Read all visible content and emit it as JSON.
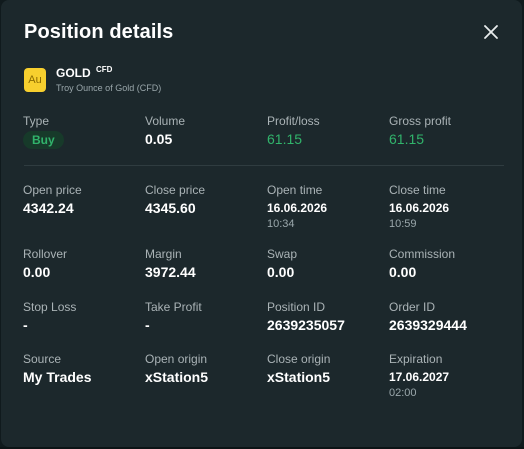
{
  "dialog": {
    "title": "Position details",
    "close_icon": "close-icon"
  },
  "instrument": {
    "logo_text": "Au",
    "logo_color": "#f7cf2e",
    "symbol": "GOLD",
    "tag": "CFD",
    "description": "Troy Ounce of Gold (CFD)"
  },
  "summary": {
    "type": {
      "label": "Type",
      "value": "Buy"
    },
    "volume": {
      "label": "Volume",
      "value": "0.05"
    },
    "profit_loss": {
      "label": "Profit/loss",
      "value": "61.15"
    },
    "gross_profit": {
      "label": "Gross profit",
      "value": "61.15"
    }
  },
  "details": {
    "open_price": {
      "label": "Open price",
      "value": "4342.24"
    },
    "close_price": {
      "label": "Close price",
      "value": "4345.60"
    },
    "open_time": {
      "label": "Open time",
      "date": "16.06.2026",
      "time": "10:34"
    },
    "close_time": {
      "label": "Close time",
      "date": "16.06.2026",
      "time": "10:59"
    },
    "rollover": {
      "label": "Rollover",
      "value": "0.00"
    },
    "margin": {
      "label": "Margin",
      "value": "3972.44"
    },
    "swap": {
      "label": "Swap",
      "value": "0.00"
    },
    "commission": {
      "label": "Commission",
      "value": "0.00"
    },
    "stop_loss": {
      "label": "Stop Loss",
      "value": "-"
    },
    "take_profit": {
      "label": "Take Profit",
      "value": "-"
    },
    "position_id": {
      "label": "Position ID",
      "value": "2639235057"
    },
    "order_id": {
      "label": "Order ID",
      "value": "2639329444"
    },
    "source": {
      "label": "Source",
      "value": "My Trades"
    },
    "open_origin": {
      "label": "Open origin",
      "value": "xStation5"
    },
    "close_origin": {
      "label": "Close origin",
      "value": "xStation5"
    },
    "expiration": {
      "label": "Expiration",
      "date": "17.06.2027",
      "time": "02:00"
    }
  },
  "colors": {
    "background": "#1c282c",
    "profit_green": "#31b36b",
    "label_gray": "#aab3b6"
  }
}
